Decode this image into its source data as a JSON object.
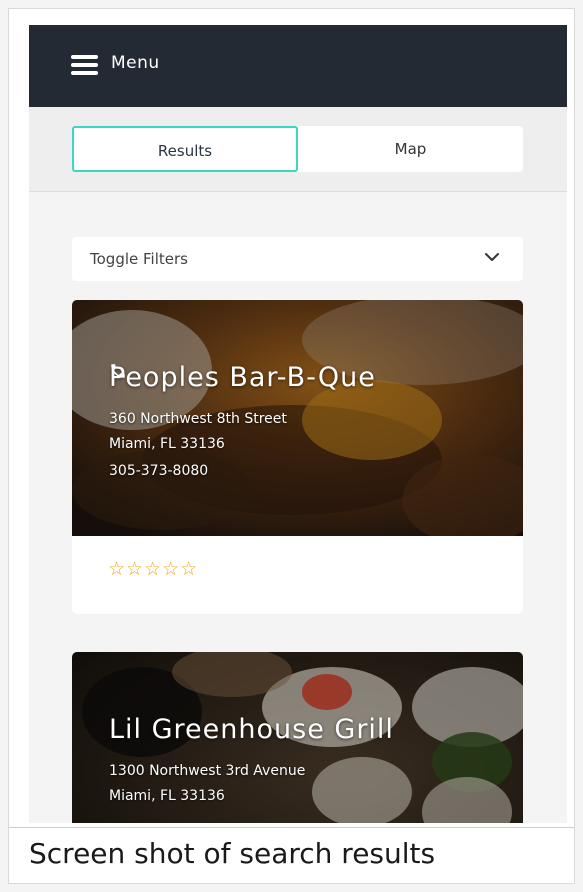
{
  "header": {
    "menu_label": "Menu",
    "icon": "hamburger-icon",
    "background": "#232a33"
  },
  "tabs": [
    {
      "label": "Results",
      "active": true
    },
    {
      "label": "Map",
      "active": false
    }
  ],
  "accent_color": "#3dd6bf",
  "filters": {
    "label": "Toggle Filters",
    "icon": "chevron-down-icon"
  },
  "results": [
    {
      "name": "Peoples Bar-B-Que",
      "address_line1": "360 Northwest 8th Street",
      "address_line2": "Miami, FL 33136",
      "phone": "305-373-8080",
      "rating_stars": "☆☆☆☆☆",
      "rating": 0,
      "star_color": "#f2a81d"
    },
    {
      "name": "Lil Greenhouse Grill",
      "address_line1": "1300 Northwest 3rd Avenue",
      "address_line2": "Miami, FL 33136"
    }
  ],
  "caption": "Screen shot of search results"
}
